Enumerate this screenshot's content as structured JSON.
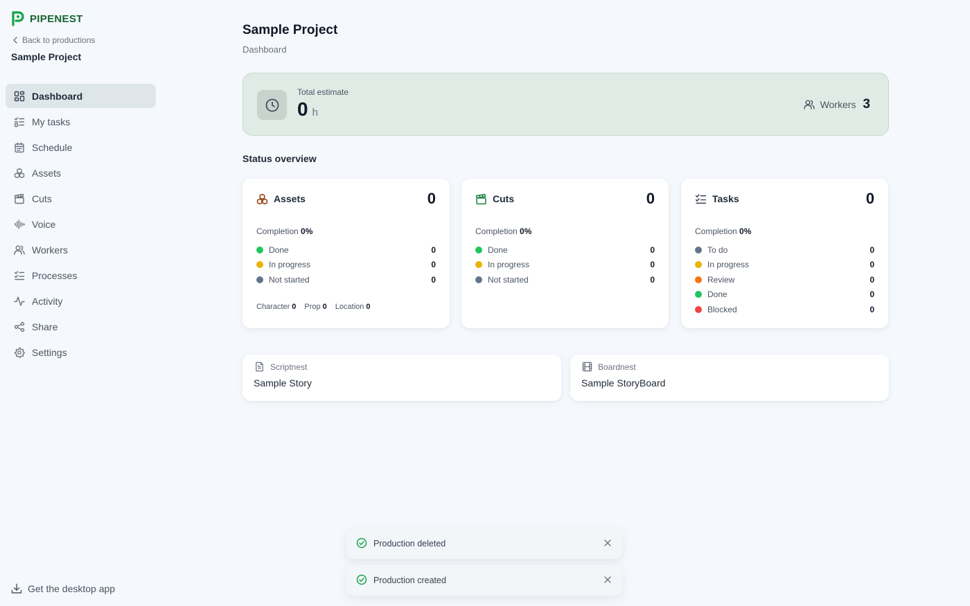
{
  "brand": {
    "name": "PIPENEST",
    "color": "#166534"
  },
  "sidebar": {
    "back_label": "Back to productions",
    "project_name": "Sample Project",
    "items": [
      {
        "label": "Dashboard",
        "icon": "dashboard-icon",
        "active": true
      },
      {
        "label": "My tasks",
        "icon": "task-list-icon"
      },
      {
        "label": "Schedule",
        "icon": "calendar-icon"
      },
      {
        "label": "Assets",
        "icon": "assets-icon"
      },
      {
        "label": "Cuts",
        "icon": "clapperboard-icon"
      },
      {
        "label": "Voice",
        "icon": "audio-wave-icon"
      },
      {
        "label": "Workers",
        "icon": "users-icon"
      },
      {
        "label": "Processes",
        "icon": "process-list-icon"
      },
      {
        "label": "Activity",
        "icon": "activity-icon"
      },
      {
        "label": "Share",
        "icon": "share-icon"
      },
      {
        "label": "Settings",
        "icon": "gear-icon"
      }
    ],
    "desktop_app_label": "Get the desktop app"
  },
  "header": {
    "title": "Sample Project",
    "subtitle": "Dashboard"
  },
  "estimate": {
    "label": "Total estimate",
    "value": "0",
    "unit": "h",
    "workers_label": "Workers",
    "workers_count": "3"
  },
  "status_overview": {
    "title": "Status overview",
    "cards": [
      {
        "title": "Assets",
        "count": "0",
        "completion_label": "Completion",
        "completion": "0%",
        "rows": [
          {
            "label": "Done",
            "value": "0",
            "color": "#22c55e"
          },
          {
            "label": "In progress",
            "value": "0",
            "color": "#eab308"
          },
          {
            "label": "Not started",
            "value": "0",
            "color": "#64748b"
          }
        ],
        "types": [
          {
            "label": "Character",
            "value": "0"
          },
          {
            "label": "Prop",
            "value": "0"
          },
          {
            "label": "Location",
            "value": "0"
          }
        ]
      },
      {
        "title": "Cuts",
        "count": "0",
        "completion_label": "Completion",
        "completion": "0%",
        "rows": [
          {
            "label": "Done",
            "value": "0",
            "color": "#22c55e"
          },
          {
            "label": "In progress",
            "value": "0",
            "color": "#eab308"
          },
          {
            "label": "Not started",
            "value": "0",
            "color": "#64748b"
          }
        ]
      },
      {
        "title": "Tasks",
        "count": "0",
        "completion_label": "Completion",
        "completion": "0%",
        "rows": [
          {
            "label": "To do",
            "value": "0",
            "color": "#64748b"
          },
          {
            "label": "In progress",
            "value": "0",
            "color": "#eab308"
          },
          {
            "label": "Review",
            "value": "0",
            "color": "#f97316"
          },
          {
            "label": "Done",
            "value": "0",
            "color": "#22c55e"
          },
          {
            "label": "Blocked",
            "value": "0",
            "color": "#ef4444"
          }
        ]
      }
    ]
  },
  "links": [
    {
      "app": "Scriptnest",
      "title": "Sample Story",
      "icon": "document-icon"
    },
    {
      "app": "Boardnest",
      "title": "Sample StoryBoard",
      "icon": "film-icon"
    }
  ],
  "toasts": [
    {
      "message": "Production deleted"
    },
    {
      "message": "Production created"
    }
  ],
  "colors": {
    "accent": "#166534",
    "success": "#16a34a",
    "assets_icon": "#92400e",
    "cuts_icon": "#15803d"
  }
}
